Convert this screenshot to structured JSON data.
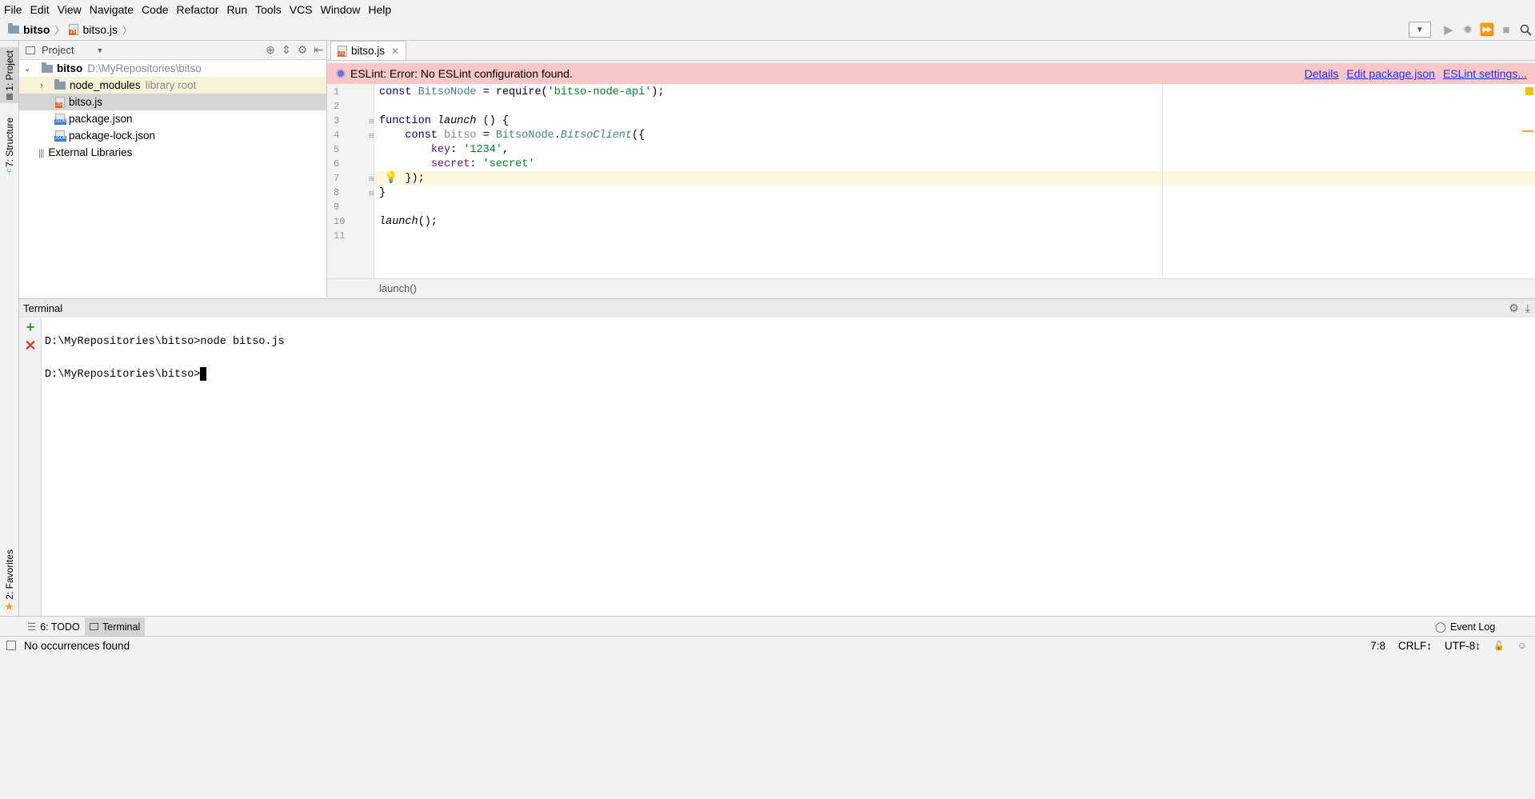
{
  "menu": [
    "File",
    "Edit",
    "View",
    "Navigate",
    "Code",
    "Refactor",
    "Run",
    "Tools",
    "VCS",
    "Window",
    "Help"
  ],
  "navbar": {
    "project": "bitso",
    "file": "bitso.js"
  },
  "tool_windows": {
    "project_tab": "1: Project",
    "structure_tab": "7: Structure",
    "favorites_tab": "2: Favorites"
  },
  "project_panel": {
    "view_label": "Project",
    "tree": [
      {
        "name": "bitso",
        "detail": "D:\\MyRepositories\\bitso"
      },
      {
        "name": "node_modules",
        "detail": "library root"
      },
      {
        "name": "bitso.js"
      },
      {
        "name": "package.json"
      },
      {
        "name": "package-lock.json"
      },
      {
        "name": "External Libraries"
      }
    ]
  },
  "editor": {
    "tab_label": "bitso.js",
    "banner": {
      "message": "ESLint: Error: No ESLint configuration found.",
      "links": [
        "Details",
        "Edit package.json",
        "ESLint settings..."
      ],
      "color": "#f9c7c7"
    },
    "line_numbers": [
      "1",
      "2",
      "3",
      "4",
      "5",
      "6",
      "7",
      "8",
      "9",
      "10",
      "11"
    ],
    "breadcrumb": "launch()"
  },
  "terminal": {
    "title": "Terminal",
    "lines": [
      "D:\\MyRepositories\\bitso>node bitso.js",
      "D:\\MyRepositories\\bitso>"
    ]
  },
  "bottom_tabs": {
    "todo": "6: TODO",
    "terminal": "Terminal",
    "event_log": "Event Log"
  },
  "status_bar": {
    "message": "No occurrences found",
    "position": "7:8",
    "line_separator": "CRLF↕",
    "encoding": "UTF-8↕"
  },
  "colors": {
    "keyword": "#000080",
    "string": "#00802a",
    "identifier": "#458383",
    "property": "#660e7a"
  }
}
